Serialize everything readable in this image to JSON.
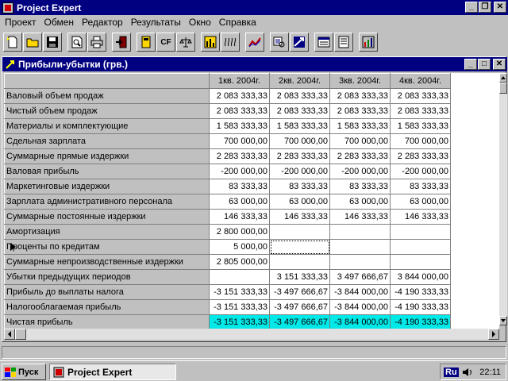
{
  "app": {
    "title": "Project Expert"
  },
  "menu": [
    "Проект",
    "Обмен",
    "Редактор",
    "Результаты",
    "Окно",
    "Справка"
  ],
  "toolbar": {
    "cf_label": "CF"
  },
  "child_window": {
    "title": "Прибыли-убытки (грв.)"
  },
  "table": {
    "columns": [
      "1кв. 2004г.",
      "2кв. 2004г.",
      "3кв. 2004г.",
      "4кв. 2004г."
    ],
    "rows": [
      {
        "label": "Валовый объем продаж",
        "values": [
          "2 083 333,33",
          "2 083 333,33",
          "2 083 333,33",
          "2 083 333,33"
        ]
      },
      {
        "label": "Чистый объем продаж",
        "values": [
          "2 083 333,33",
          "2 083 333,33",
          "2 083 333,33",
          "2 083 333,33"
        ]
      },
      {
        "label": "Материалы и комплектующие",
        "values": [
          "1 583 333,33",
          "1 583 333,33",
          "1 583 333,33",
          "1 583 333,33"
        ]
      },
      {
        "label": "Сдельная зарплата",
        "values": [
          "700 000,00",
          "700 000,00",
          "700 000,00",
          "700 000,00"
        ]
      },
      {
        "label": "Суммарные прямые издержки",
        "values": [
          "2 283 333,33",
          "2 283 333,33",
          "2 283 333,33",
          "2 283 333,33"
        ]
      },
      {
        "label": "Валовая прибыль",
        "values": [
          "-200 000,00",
          "-200 000,00",
          "-200 000,00",
          "-200 000,00"
        ]
      },
      {
        "label": "Маркетинговые издержки",
        "values": [
          "83 333,33",
          "83 333,33",
          "83 333,33",
          "83 333,33"
        ]
      },
      {
        "label": "Зарплата административного персонала",
        "values": [
          "63 000,00",
          "63 000,00",
          "63 000,00",
          "63 000,00"
        ]
      },
      {
        "label": "Суммарные постоянные издержки",
        "values": [
          "146 333,33",
          "146 333,33",
          "146 333,33",
          "146 333,33"
        ]
      },
      {
        "label": "Амортизация",
        "values": [
          "2 800 000,00",
          "",
          "",
          ""
        ]
      },
      {
        "label": "Проценты по кредитам",
        "values": [
          "5 000,00",
          "",
          "",
          ""
        ]
      },
      {
        "label": "Суммарные непроизводственные издержки",
        "values": [
          "2 805 000,00",
          "",
          "",
          ""
        ]
      },
      {
        "label": "Убытки предыдущих периодов",
        "values": [
          "",
          "3 151 333,33",
          "3 497 666,67",
          "3 844 000,00"
        ]
      },
      {
        "label": "Прибыль до выплаты налога",
        "values": [
          "-3 151 333,33",
          "-3 497 666,67",
          "-3 844 000,00",
          "-4 190 333,33"
        ]
      },
      {
        "label": "Налогооблагаемая прибыль",
        "values": [
          "-3 151 333,33",
          "-3 497 666,67",
          "-3 844 000,00",
          "-4 190 333,33"
        ]
      },
      {
        "label": "Чистая прибыль",
        "values": [
          "-3 151 333,33",
          "-3 497 666,67",
          "-3 844 000,00",
          "-4 190 333,33"
        ]
      }
    ]
  },
  "taskbar": {
    "start_label": "Пуск",
    "task_label": "Project Expert",
    "lang": "Ru",
    "time": "22:11"
  },
  "colors": {
    "title_bg": "#000080",
    "highlight": "#00e8e8",
    "face": "#c0c0c0"
  }
}
